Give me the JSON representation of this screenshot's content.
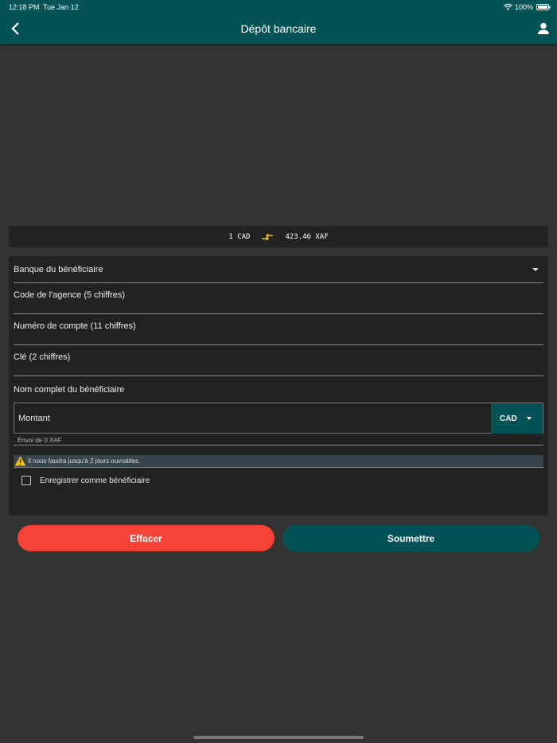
{
  "status": {
    "time": "12:18 PM",
    "date": "Tue Jan 12",
    "battery": "100%"
  },
  "header": {
    "title": "Dépôt bancaire"
  },
  "rate": {
    "from": "1 CAD",
    "to": "423.46 XAF"
  },
  "form": {
    "bank": "Banque du bénéficiaire",
    "agency": "Code de l'agence (5 chiffres)",
    "account": "Numéro de compte (11 chiffres)",
    "key": "Clé (2 chiffres)",
    "name": "Nom complet du bénéficiaire",
    "amount_placeholder": "Montant",
    "currency": "CAD",
    "sending": "Envoi de  0 XAF",
    "warning": "Il nous faudra jusqu'à 2 jours ouvrables.",
    "save_beneficiary": "Enregistrer comme bénéficiaire"
  },
  "buttons": {
    "clear": "Effacer",
    "submit": "Soumettre"
  },
  "colors": {
    "primary": "#035256",
    "danger": "#f44336",
    "accent": "#f5c518"
  }
}
